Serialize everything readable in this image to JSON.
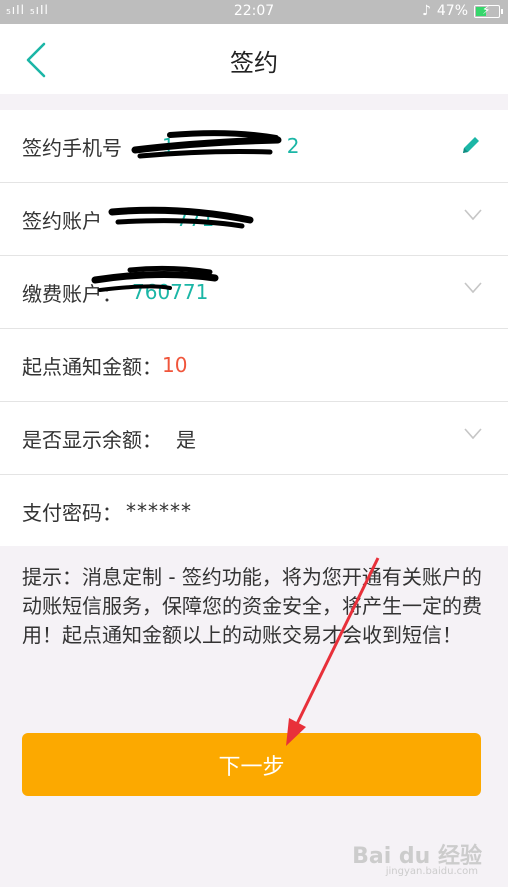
{
  "status_bar": {
    "signal": "₅ıIl ₅ıIl",
    "time": "22:07",
    "battery_percent": "47%",
    "battery_level": 0.47
  },
  "header": {
    "title": "签约"
  },
  "form": {
    "rows": [
      {
        "label": "签约手机号",
        "value": "1",
        "value_tail": "2"
      },
      {
        "label": "签约账户",
        "value": "771"
      },
      {
        "label": "缴费账户：",
        "value": "760771"
      },
      {
        "label": "起点通知金额：",
        "value": "10"
      },
      {
        "label": "是否显示余额：",
        "value": "是"
      },
      {
        "label": "支付密码：",
        "value": "******"
      }
    ]
  },
  "hint": {
    "text": "提示：消息定制 - 签约功能，将为您开通有关账户的动账短信服务，保障您的资金安全，将产生一定的费用！起点通知金额以上的动账交易才会收到短信！"
  },
  "next_button": {
    "label": "下一步"
  },
  "watermark": {
    "text": "Bai du 经验",
    "sub": "jingyan.baidu.com"
  },
  "colors": {
    "accent_teal": "#1bb6a6",
    "button_orange": "#fca900",
    "amount_red": "#f0553b"
  }
}
